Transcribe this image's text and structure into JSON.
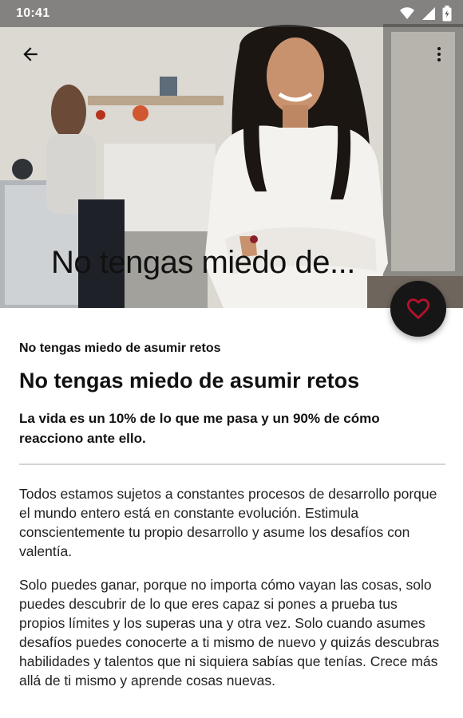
{
  "status_bar": {
    "time": "10:41"
  },
  "hero": {
    "title": "No tengas miedo de...",
    "back_icon": "arrow-back-icon",
    "menu_icon": "more-vert-icon"
  },
  "fab": {
    "icon": "heart-outline-icon",
    "color": "#b3122e"
  },
  "article": {
    "overline": "No tengas miedo de asumir retos",
    "title": "No tengas miedo de asumir retos",
    "subtitle": "La vida es un 10% de lo que me pasa y un 90% de cómo reacciono ante ello.",
    "paragraphs": [
      "Todos estamos sujetos a constantes procesos de desarrollo porque el mundo entero está en constante evolución. Estimula conscientemente tu propio desarrollo y asume los desafíos con valentía.",
      "Solo puedes ganar, porque no importa cómo vayan las cosas, solo puedes descubrir de lo que eres capaz si pones a prueba tus propios límites y los superas una y otra vez. Solo cuando asumes desafíos puedes conocerte a ti mismo de nuevo y quizás descubras habilidades y talentos que ni siquiera sabías que tenías. Crece más allá de ti mismo y aprende cosas nuevas."
    ]
  }
}
